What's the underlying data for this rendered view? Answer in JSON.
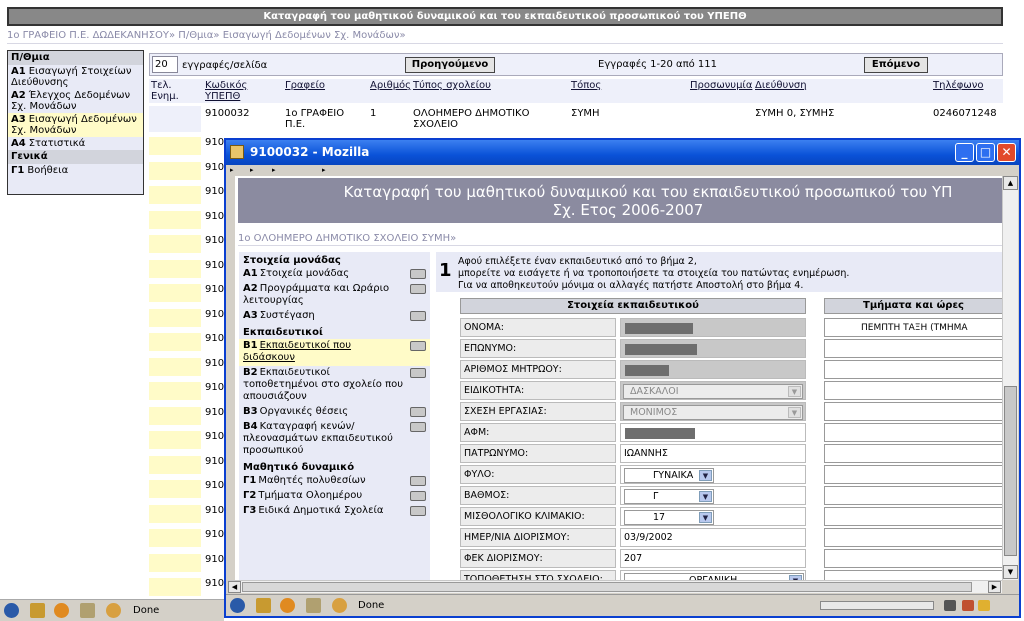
{
  "main": {
    "banner": "Καταγραφή του μαθητικού δυναμικού και του εκπαιδευτικού προσωπικού του ΥΠΕΠΘ",
    "breadcrumb": "1ο ΓΡΑΦΕΙΟ Π.Ε. ΔΩΔΕΚΑΝΗΣΟΥ» Π/Θμια» Εισαγωγή Δεδομένων Σχ. Μονάδων»",
    "nav": {
      "header1": "Π/Θμια",
      "items": [
        {
          "code": "A1",
          "label": "Εισαγωγή Στοιχείων Διεύθυνσης"
        },
        {
          "code": "A2",
          "label": "Έλεγχος Δεδομένων Σχ. Μονάδων"
        },
        {
          "code": "A3",
          "label": "Εισαγωγή Δεδομένων Σχ. Μονάδων"
        },
        {
          "code": "A4",
          "label": "Στατιστικά"
        }
      ],
      "header2": "Γενικά",
      "help": {
        "code": "Γ1",
        "label": "Βοήθεια"
      }
    },
    "pager": {
      "page_size": "20",
      "page_size_label": "εγγραφές/σελίδα",
      "prev": "Προηγούμενο",
      "info": "Εγγραφές 1-20 από 111",
      "next": "Επόμενο"
    },
    "columns": [
      "Τελ. Ενημ.",
      "Κωδικός ΥΠΕΠΘ",
      "Γραφείο",
      "Αριθμός",
      "Τύπος σχολείου",
      "Τόπος",
      "Προσωνυμία",
      "Διεύθυνση",
      "Τηλέφωνο"
    ],
    "first_row": {
      "code": "9100032",
      "office": "1ο ΓΡΑΦΕΙΟ Π.Ε.",
      "number": "1",
      "type": "ΟΛΟΗΜΕΡΟ ΔΗΜΟΤΙΚΟ ΣΧΟΛΕΙΟ",
      "place": "ΣΥΜΗ",
      "name": "",
      "address": "ΣΥΜΗ 0, ΣΥΜΗΣ",
      "phone": "0246071248"
    },
    "partial_codes": [
      "910",
      "910",
      "910",
      "910",
      "910",
      "910",
      "910",
      "910",
      "910",
      "910",
      "910",
      "910",
      "910",
      "910",
      "910",
      "910",
      "910",
      "910",
      "910"
    ],
    "status_text": "Done"
  },
  "popup": {
    "title": "9100032 - Mozilla",
    "buttons": {
      "minimize": "_",
      "maximize": "□",
      "close": "✕"
    },
    "page_title_line1": "Καταγραφή του μαθητικού δυναμικού και του εκπαιδευτικού προσωπικού του ΥΠ",
    "page_title_line2": "Σχ. Ετος 2006-2007",
    "breadcrumb": "1ο ΟΛΟΗΜΕΡΟ ΔΗΜΟΤΙΚΟ ΣΧΟΛΕΙΟ ΣΥΜΗ»",
    "nav": [
      {
        "type": "header",
        "label": "Στοιχεία μονάδας"
      },
      {
        "type": "item",
        "code": "A1",
        "label": "Στοιχεία μονάδας",
        "printer": true
      },
      {
        "type": "item",
        "code": "A2",
        "label": "Προγράμματα και Ωράριο λειτουργίας",
        "printer": true
      },
      {
        "type": "item",
        "code": "A3",
        "label": "Συστέγαση",
        "printer": true
      },
      {
        "type": "header",
        "label": "Εκπαιδευτικοί"
      },
      {
        "type": "item",
        "code": "B1",
        "label": "Εκπαιδευτικοί που διδάσκουν",
        "printer": true,
        "selected": true
      },
      {
        "type": "item",
        "code": "B2",
        "label": "Εκπαιδευτικοί τοποθετημένοι στο σχολείο που απουσιάζουν",
        "printer": true
      },
      {
        "type": "item",
        "code": "B3",
        "label": "Οργανικές θέσεις",
        "printer": true
      },
      {
        "type": "item",
        "code": "B4",
        "label": "Καταγραφή κενών/πλεονασμάτων εκπαιδευτικού προσωπικού",
        "printer": true
      },
      {
        "type": "header",
        "label": "Μαθητικό δυναμικό"
      },
      {
        "type": "item",
        "code": "Γ1",
        "label": "Μαθητές πολυθεσίων",
        "printer": true
      },
      {
        "type": "item",
        "code": "Γ2",
        "label": "Τμήματα Ολοημέρου",
        "printer": true
      },
      {
        "type": "item",
        "code": "Γ3",
        "label": "Ειδικά Δημοτικά Σχολεία",
        "printer": true
      }
    ],
    "step": {
      "number": "1",
      "line1": "Αφού επιλέξετε έναν εκπαιδευτικό από το βήμα 2,",
      "line2": "μπορείτε να εισάγετε ή να τροποποιήσετε τα στοιχεία του πατώντας ενημέρωση.",
      "line3": "Για να αποθηκευτούν μόνιμα οι αλλαγές πατήστε Αποστολή στο βήμα 4."
    },
    "form": {
      "header": "Στοιχεία εκπαιδευτικού",
      "fields": [
        {
          "label": "ΟΝΟΜΑ:",
          "kind": "masked",
          "mask_width": 68
        },
        {
          "label": "ΕΠΩΝΥΜΟ:",
          "kind": "masked",
          "mask_width": 72
        },
        {
          "label": "ΑΡΙΘΜΟΣ ΜΗΤΡΩΟΥ:",
          "kind": "masked",
          "mask_width": 44
        },
        {
          "label": "ΕΙΔΙΚΟΤΗΤΑ:",
          "kind": "select-disabled",
          "value": "ΔΑΣΚΑΛΟΙ"
        },
        {
          "label": "ΣΧΕΣΗ ΕΡΓΑΣΙΑΣ:",
          "kind": "select-disabled",
          "value": "ΜΟΝΙΜΟΣ"
        },
        {
          "label": "ΑΦΜ:",
          "kind": "masked-white",
          "mask_width": 70
        },
        {
          "label": "ΠΑΤΡΩΝΥΜΟ:",
          "kind": "text",
          "value": "ΙΩΑΝΝΗΣ"
        },
        {
          "label": "ΦΥΛΟ:",
          "kind": "select",
          "value": "ΓΥΝΑΙΚΑ"
        },
        {
          "label": "ΒΑΘΜΟΣ:",
          "kind": "select",
          "value": "Γ"
        },
        {
          "label": "ΜΙΣΘΟΛΟΓΙΚΟ ΚΛΙΜΑΚΙΟ:",
          "kind": "select",
          "value": "17"
        },
        {
          "label": "ΗΜΕΡ/ΝΙΑ ΔΙΟΡΙΣΜΟΥ:",
          "kind": "text",
          "value": "03/9/2002"
        },
        {
          "label": "ΦΕΚ ΔΙΟΡΙΣΜΟΥ:",
          "kind": "text",
          "value": "207"
        },
        {
          "label": "ΤΟΠΟΘΕΤΗΣΗ ΣΤΟ ΣΧΟΛΕΙΟ:",
          "kind": "select",
          "value": "ΟΡΓΑΝΙΚΗ"
        }
      ]
    },
    "classes": {
      "header": "Τμήματα και ώρες",
      "first": "ΠΕΜΠΤΗ ΤΑΞΗ (ΤΜΗΜΑ",
      "count": 13
    },
    "status_text": "Done"
  }
}
